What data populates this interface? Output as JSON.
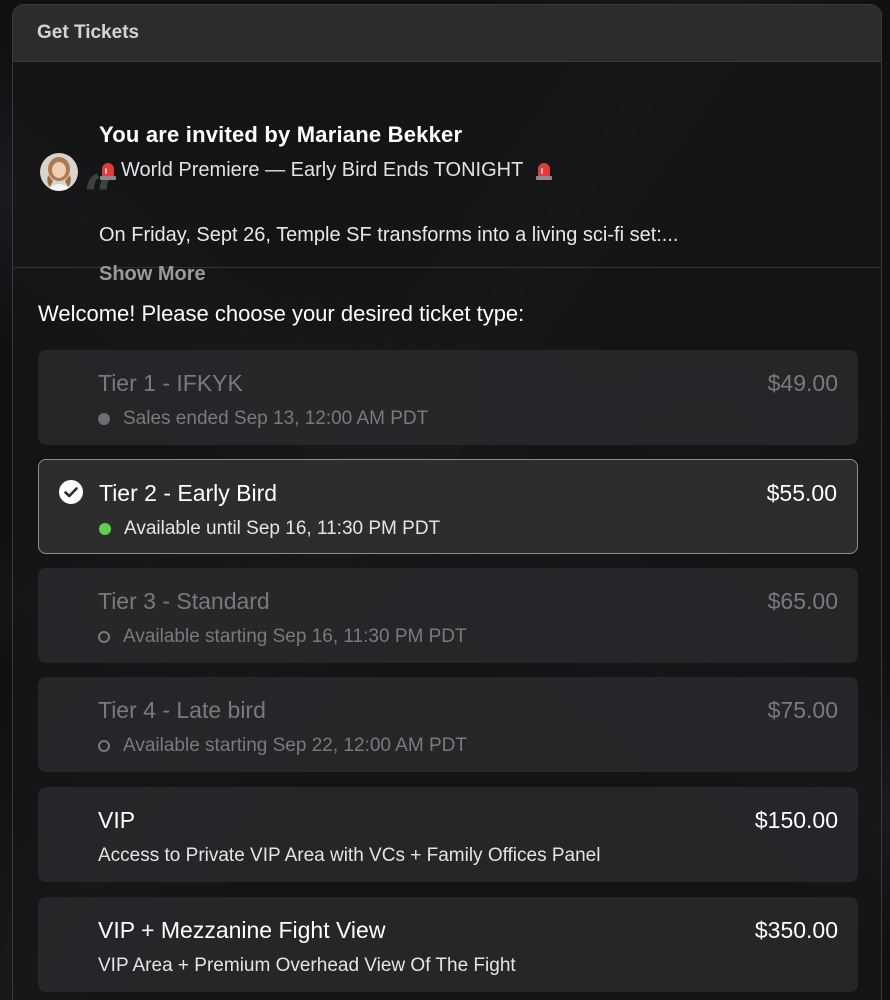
{
  "panel": {
    "title": "Get Tickets"
  },
  "invite": {
    "title": "You are invited by Mariane Bekker",
    "event_line": "World Premiere — Early Bird Ends TONIGHT",
    "description": "On Friday, Sept 26, Temple SF transforms into a living sci-fi set:...",
    "show_more": "Show More",
    "avatar_icon": "profile-photo"
  },
  "prompt": "Welcome! Please choose your desired ticket type:",
  "tickets": [
    {
      "name": "Tier 1 - IFKYK",
      "price": "$49.00",
      "sub": "Sales ended Sep 13, 12:00 AM PDT",
      "status": "ended",
      "selected": false
    },
    {
      "name": "Tier 2 - Early Bird",
      "price": "$55.00",
      "sub": "Available until Sep 16, 11:30 PM PDT",
      "status": "available",
      "selected": true
    },
    {
      "name": "Tier 3 - Standard",
      "price": "$65.00",
      "sub": "Available starting Sep 16, 11:30 PM PDT",
      "status": "upcoming",
      "selected": false
    },
    {
      "name": "Tier 4 - Late bird",
      "price": "$75.00",
      "sub": "Available starting Sep 22, 12:00 AM PDT",
      "status": "upcoming",
      "selected": false
    },
    {
      "name": "VIP",
      "price": "$150.00",
      "sub": "Access to Private VIP Area with VCs + Family Offices Panel",
      "status": "info",
      "selected": false
    },
    {
      "name": "VIP + Mezzanine Fight View",
      "price": "$350.00",
      "sub": "VIP Area + Premium Overhead View Of The Fight",
      "status": "info",
      "selected": false
    }
  ],
  "colors": {
    "available_dot": "#5fcf4f",
    "ended_dot": "#6f6f73",
    "selected_border": "#8c8c90",
    "siren": "#e23b3b"
  }
}
